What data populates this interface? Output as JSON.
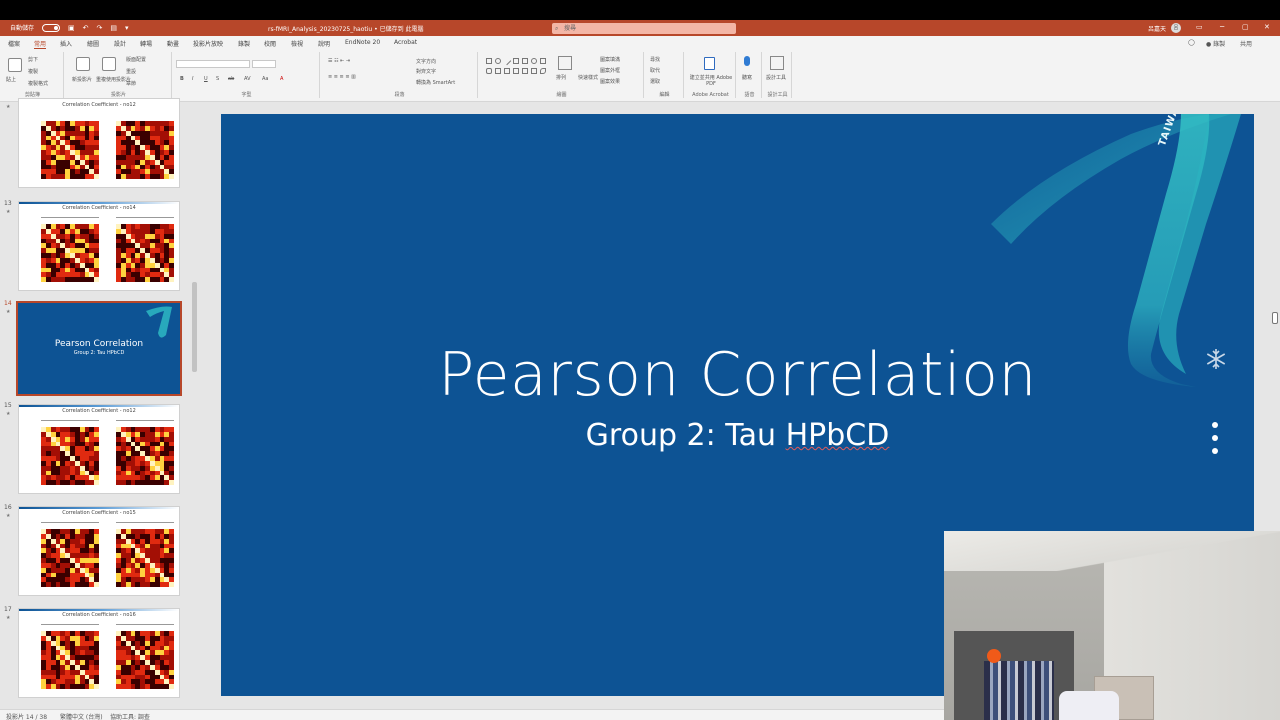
{
  "titlebar": {
    "autosave_label": "自動儲存",
    "autosave_toggle": "關",
    "document_title": "rs-fMRI_Analysis_20230725_haotiu • 已儲存到 此電腦",
    "search_placeholder": "搜尋",
    "user_name": "呂嘉天",
    "avatar_initials": "呂",
    "ribbon_display_icon": "ribbon-display-icon",
    "minimize_icon": "─",
    "restore_icon": "▢",
    "close_icon": "✕"
  },
  "menu": {
    "tabs": [
      "檔案",
      "常用",
      "插入",
      "繪圖",
      "設計",
      "轉場",
      "動畫",
      "投影片放映",
      "錄製",
      "校閱",
      "檢視",
      "說明",
      "EndNote 20",
      "Acrobat"
    ],
    "active_index": 1,
    "comment_label": "◯",
    "record_label": "● 錄製",
    "share_label": "共用"
  },
  "ribbon": {
    "groups": [
      {
        "label": "剪貼簿",
        "buttons": [
          "貼上",
          "剪下",
          "複製",
          "複製格式"
        ]
      },
      {
        "label": "投影片",
        "buttons": [
          "新投影片",
          "重複使用投影片",
          "版面配置",
          "重設",
          "章節"
        ]
      },
      {
        "label": "字型",
        "buttons": [
          "B",
          "I",
          "U",
          "S",
          "ab",
          "AV",
          "Aa",
          "A"
        ]
      },
      {
        "label": "段落",
        "buttons": [
          "文字方向",
          "對齊文字",
          "轉換為 SmartArt"
        ]
      },
      {
        "label": "繪圖",
        "buttons": [
          "排列",
          "快速樣式",
          "圖案填滿",
          "圖案外框",
          "圖案效果"
        ]
      },
      {
        "label": "編輯",
        "buttons": [
          "尋找",
          "取代",
          "選取"
        ]
      },
      {
        "label": "Adobe Acrobat",
        "buttons": [
          "建立並共用 Adobe PDF"
        ]
      },
      {
        "label": "語音",
        "buttons": [
          "聽寫"
        ]
      },
      {
        "label": "設計工具",
        "buttons": [
          "設計工具"
        ]
      }
    ]
  },
  "thumbnails": [
    {
      "number": "",
      "title": "Correlation Coefficient - no12",
      "type": "heatmap",
      "selected": false
    },
    {
      "number": "13",
      "title": "Correlation Coefficient - no14",
      "type": "heatmap",
      "selected": false
    },
    {
      "number": "14",
      "title": "Pearson Correlation",
      "subtitle": "Group 2: Tau HPbCD",
      "type": "title",
      "selected": true
    },
    {
      "number": "15",
      "title": "Correlation Coefficient - no12",
      "type": "heatmap",
      "selected": false
    },
    {
      "number": "16",
      "title": "Correlation Coefficient - no15",
      "type": "heatmap",
      "selected": false
    },
    {
      "number": "17",
      "title": "Correlation Coefficient - no16",
      "type": "heatmap",
      "selected": false
    }
  ],
  "slide": {
    "title": "Pearson Correlation",
    "subtitle_prefix": "Group 2: Tau ",
    "subtitle_flagged": "HPbCD",
    "ribbon_text": "TAIWAN",
    "colors": {
      "background": "#0d5394",
      "ribbon": "#2bb3c0",
      "text": "#ffffff"
    }
  },
  "statusbar": {
    "slide_counter": "投影片 14 / 38",
    "language": "繁體中文 (台灣)",
    "accessibility": "協助工具: 調查"
  },
  "colors": {
    "accent": "#b7472a",
    "heatmap_low": "#3a0000",
    "heatmap_high": "#ffe066"
  }
}
